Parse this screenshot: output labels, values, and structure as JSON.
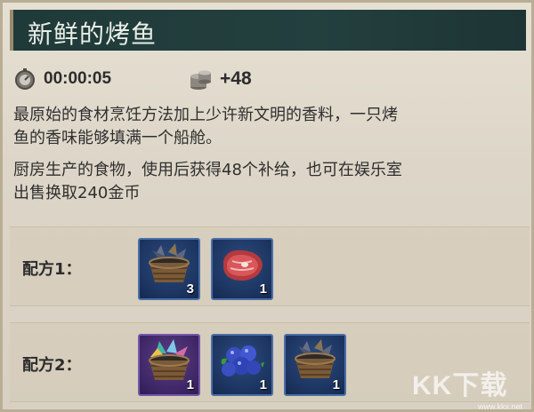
{
  "item": {
    "title": "新鲜的烤鱼",
    "cook_time": "00:00:05",
    "supply_bonus": "+48",
    "description_lines": [
      "最原始的食材烹饪方法加上少许新文明的香料，一只烤",
      "鱼的香味能够填满一个船舱。"
    ],
    "usage_lines": [
      "厨房生产的食物，使用后获得48个补给，也可在娱乐室",
      "出售换取240金币"
    ]
  },
  "recipes": [
    {
      "label": "配方1：",
      "ingredients": [
        {
          "icon": "fish-basket-icon",
          "qty": "3",
          "rarity": "blue"
        },
        {
          "icon": "raw-meat-icon",
          "qty": "1",
          "rarity": "blue"
        }
      ]
    },
    {
      "label": "配方2：",
      "ingredients": [
        {
          "icon": "rare-fish-basket-icon",
          "qty": "1",
          "rarity": "purple"
        },
        {
          "icon": "blueberries-icon",
          "qty": "1",
          "rarity": "blue"
        },
        {
          "icon": "fish-basket-icon",
          "qty": "1",
          "rarity": "blue"
        }
      ]
    }
  ],
  "watermark": {
    "logo_text": "KK下载",
    "url": "www.kkx.net"
  }
}
